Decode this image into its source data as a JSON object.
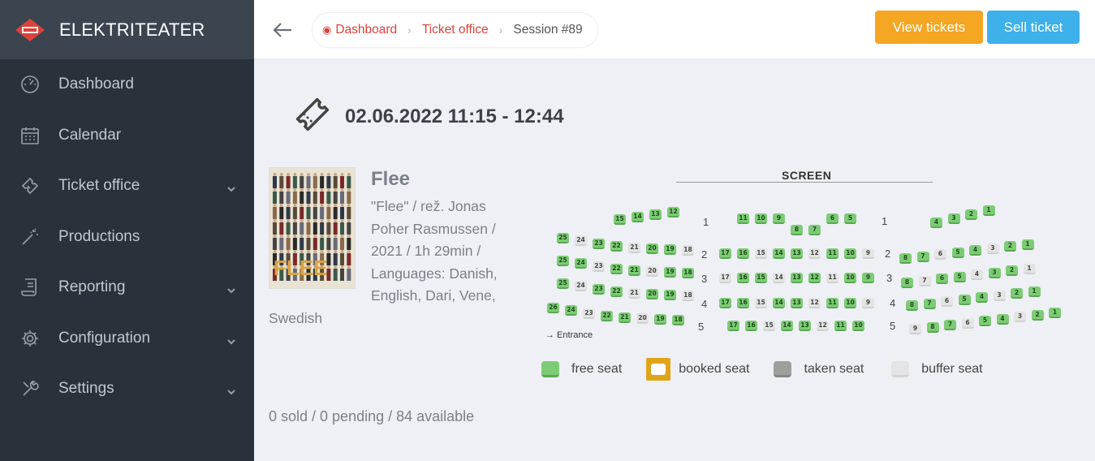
{
  "brand": {
    "name": "ELEKTRITEATER"
  },
  "sidebar": {
    "items": [
      {
        "label": "Dashboard",
        "icon": "gauge-icon",
        "has_children": false
      },
      {
        "label": "Calendar",
        "icon": "calendar-icon",
        "has_children": false
      },
      {
        "label": "Ticket office",
        "icon": "ticket-icon",
        "has_children": true
      },
      {
        "label": "Productions",
        "icon": "magic-wand-icon",
        "has_children": false
      },
      {
        "label": "Reporting",
        "icon": "report-icon",
        "has_children": true
      },
      {
        "label": "Configuration",
        "icon": "gear-icon",
        "has_children": true
      },
      {
        "label": "Settings",
        "icon": "tools-icon",
        "has_children": true
      }
    ]
  },
  "breadcrumb": {
    "items": [
      {
        "label": "Dashboard",
        "link": true
      },
      {
        "label": "Ticket office",
        "link": true
      },
      {
        "label": "Session #89",
        "link": false
      }
    ]
  },
  "actions": {
    "view_tickets": "View tickets",
    "sell_ticket": "Sell ticket"
  },
  "session": {
    "datetime": "02.06.2022 11:15 - 12:44"
  },
  "film": {
    "title": "Flee",
    "description_lines": [
      "\"Flee\" / rež. Jonas",
      "Poher Rasmussen /",
      "2021 / 1h 29min /",
      "Languages: Danish,",
      "English, Dari, Vene,",
      "Swedish"
    ]
  },
  "stats": {
    "text": "0 sold / 0 pending / 84 available"
  },
  "seatmap": {
    "screen_label": "SCREEN",
    "entrance_label": "→ Entrance",
    "row_labels": [
      "1",
      "2",
      "3",
      "4",
      "5"
    ],
    "sections": {
      "left": [
        [
          "15",
          "14",
          "13",
          "12"
        ],
        [
          "25",
          "24",
          "23",
          "22",
          "21",
          "20",
          "19",
          "18"
        ],
        [
          "25",
          "24",
          "23",
          "22",
          "21",
          "20",
          "19",
          "18"
        ],
        [
          "25",
          "24",
          "23",
          "22",
          "21",
          "20",
          "19",
          "18"
        ],
        [
          "26",
          "24",
          "23",
          "22",
          "21",
          "20",
          "19",
          "18"
        ]
      ],
      "center": [
        [
          "11",
          "10",
          "9",
          "8",
          "7",
          "6",
          "5"
        ],
        [
          "17",
          "16",
          "15",
          "14",
          "13",
          "12",
          "11",
          "10",
          "9"
        ],
        [
          "17",
          "16",
          "15",
          "14",
          "13",
          "12",
          "11",
          "10",
          "9"
        ],
        [
          "17",
          "16",
          "15",
          "14",
          "13",
          "12",
          "11",
          "10",
          "9"
        ],
        [
          "17",
          "16",
          "15",
          "14",
          "13",
          "12",
          "11",
          "10"
        ]
      ],
      "right": [
        [
          "4",
          "3",
          "2",
          "1"
        ],
        [
          "8",
          "7",
          "6",
          "5",
          "4",
          "3",
          "2",
          "1"
        ],
        [
          "8",
          "7",
          "6",
          "5",
          "4",
          "3",
          "2",
          "1"
        ],
        [
          "8",
          "7",
          "6",
          "5",
          "4",
          "3",
          "2",
          "1"
        ],
        [
          "9",
          "8",
          "7",
          "6",
          "5",
          "4",
          "3",
          "2",
          "1"
        ]
      ]
    },
    "buffer_seats": {
      "left": [
        [],
        [
          "24",
          "21",
          "18"
        ],
        [
          "23",
          "20"
        ],
        [
          "24",
          "21",
          "18"
        ],
        [
          "23",
          "20"
        ]
      ],
      "center": [
        [],
        [
          "15",
          "12",
          "9"
        ],
        [
          "17",
          "14",
          "11"
        ],
        [
          "15",
          "12",
          "9"
        ],
        [
          "15",
          "12"
        ]
      ],
      "right": [
        [],
        [
          "6",
          "3"
        ],
        [
          "7",
          "4",
          "1"
        ],
        [
          "6",
          "3"
        ],
        [
          "9",
          "6",
          "3"
        ]
      ]
    }
  },
  "legend": [
    {
      "label": "free seat",
      "color": "#7dcc75"
    },
    {
      "label": "booked seat",
      "color": "#e0a419"
    },
    {
      "label": "taken seat",
      "color": "#9e9e9e"
    },
    {
      "label": "buffer seat",
      "color": "#e4e4e4"
    }
  ],
  "colors": {
    "sidebar_bg": "#2b313a",
    "accent_red": "#d9433b",
    "view_btn": "#f5a623",
    "sell_btn": "#3eb0ea"
  }
}
